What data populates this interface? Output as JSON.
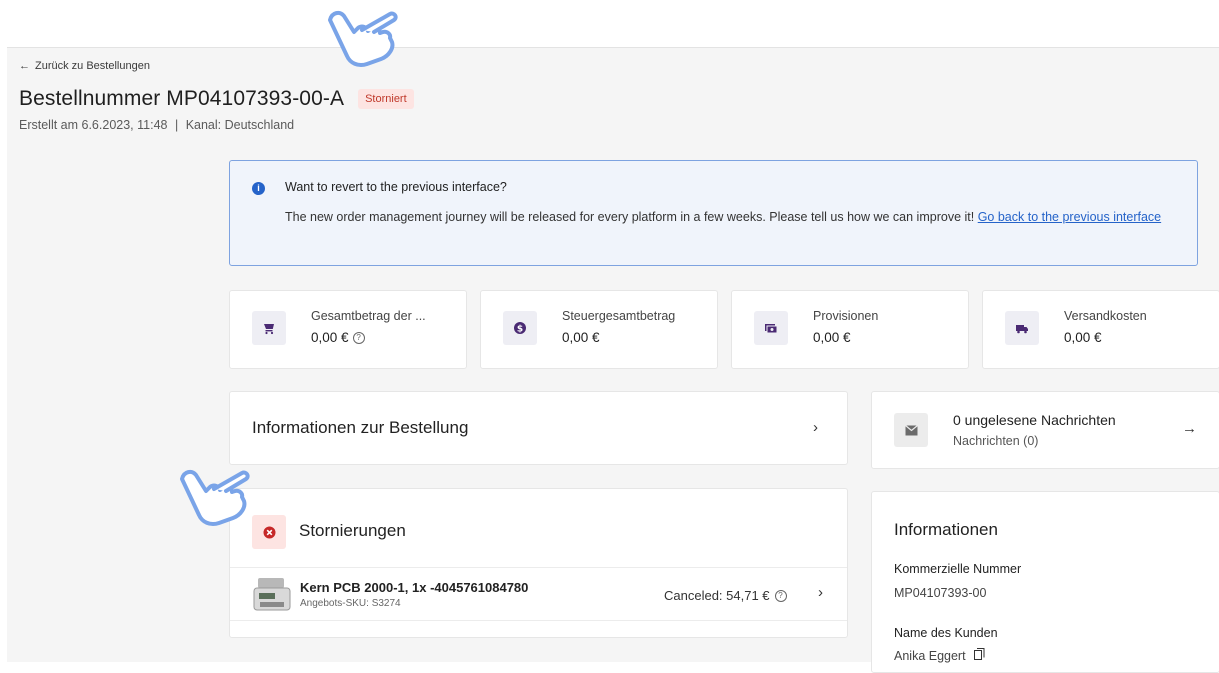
{
  "nav": {
    "back_label": "Zurück zu Bestellungen"
  },
  "order": {
    "title": "Bestellnummer MP04107393-00-A",
    "status_badge": "Storniert",
    "created": "Erstellt am 6.6.2023, 11:48",
    "channel_separator": "|",
    "channel": "Kanal: Deutschland"
  },
  "banner": {
    "title": "Want to revert to the previous interface?",
    "text": "The new order management journey will be released for every platform in a few weeks. Please tell us how we can improve it!",
    "link": "Go back to the previous interface"
  },
  "stats": [
    {
      "label": "Gesamtbetrag der ...",
      "value": "0,00 €",
      "icon": "cart-icon",
      "help": true
    },
    {
      "label": "Steuergesamtbetrag",
      "value": "0,00 €",
      "icon": "dollar-coin-icon"
    },
    {
      "label": "Provisionen",
      "value": "0,00 €",
      "icon": "money-stack-icon"
    },
    {
      "label": "Versandkosten",
      "value": "0,00 €",
      "icon": "truck-icon"
    }
  ],
  "order_info": {
    "label": "Informationen zur Bestellung"
  },
  "messages": {
    "title": "0 ungelesene Nachrichten",
    "subtitle": "Nachrichten (0)"
  },
  "cancellations": {
    "title": "Stornierungen",
    "items": [
      {
        "name": "Kern PCB 2000-1, 1x -4045761084780",
        "sku": "Angebots-SKU: S3274",
        "amount": "Canceled: 54,71 €"
      }
    ]
  },
  "info": {
    "title": "Informationen",
    "commercial_number_label": "Kommerzielle Nummer",
    "commercial_number": "MP04107393-00",
    "customer_label": "Name des Kunden",
    "customer_name": "Anika Eggert"
  },
  "colors": {
    "accent": "#2563c9",
    "badge_bg": "#fde4e2",
    "badge_text": "#c0392b",
    "stat_icon": "#4a2a73",
    "pointer": "#7aa4e8"
  }
}
